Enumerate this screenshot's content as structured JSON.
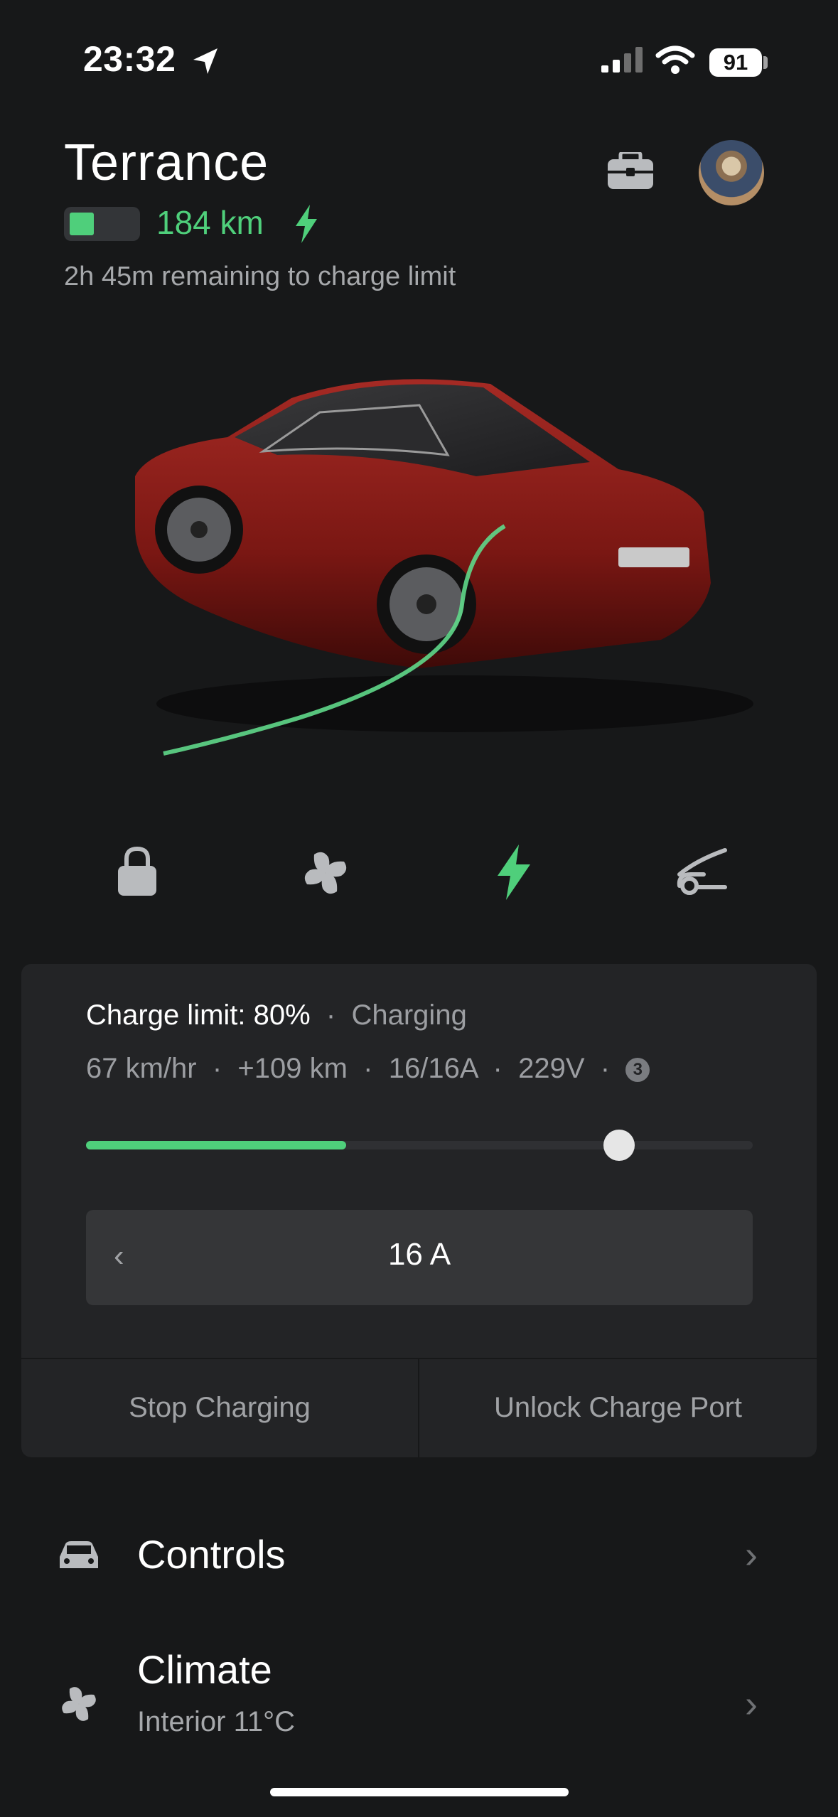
{
  "status_bar": {
    "time": "23:32",
    "battery": "91"
  },
  "header": {
    "car_name": "Terrance",
    "range": "184 km",
    "remaining": "2h 45m remaining to charge limit"
  },
  "charge_panel": {
    "limit_label": "Charge limit: 80%",
    "state": "Charging",
    "stats": [
      "67 km/hr",
      "+109 km",
      "16/16A",
      "229V"
    ],
    "phases": "3",
    "current_charge_fraction": 0.39,
    "charge_limit_fraction": 0.8,
    "amps": "16 A",
    "stop_label": "Stop Charging",
    "unlock_label": "Unlock Charge Port"
  },
  "list": {
    "controls": {
      "title": "Controls"
    },
    "climate": {
      "title": "Climate",
      "subtitle": "Interior 11°C"
    }
  },
  "colors": {
    "accent": "#4fcf7b",
    "background": "#171819",
    "panel": "#232426"
  }
}
